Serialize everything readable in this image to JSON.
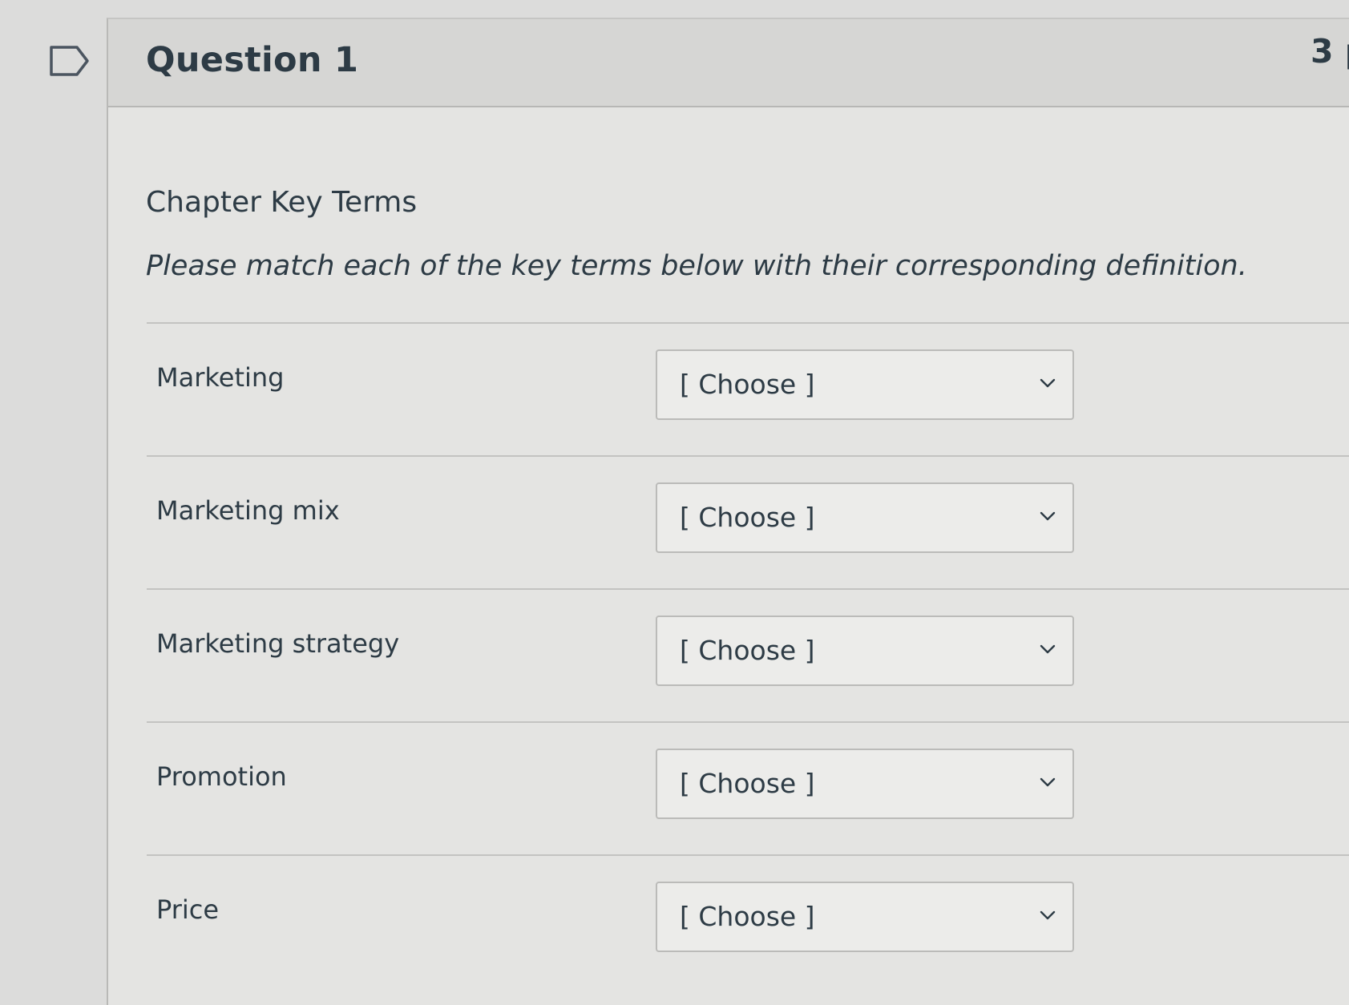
{
  "question": {
    "title": "Question 1",
    "points": "3 p"
  },
  "content": {
    "heading": "Chapter Key Terms",
    "instruction": "Please match each of the key terms below with their corresponding definition."
  },
  "matches": [
    {
      "term": "Marketing",
      "selected": "[ Choose ]"
    },
    {
      "term": "Marketing mix",
      "selected": "[ Choose ]"
    },
    {
      "term": "Marketing strategy",
      "selected": "[ Choose ]"
    },
    {
      "term": "Promotion",
      "selected": "[ Choose ]"
    },
    {
      "term": "Price",
      "selected": "[ Choose ]"
    }
  ],
  "icons": {
    "flag": "flag-outline-icon",
    "dropdown": "chevron-down-icon"
  },
  "colors": {
    "text": "#2d3b45",
    "page_background": "#dcdcdb",
    "card_background": "#e4e4e2",
    "header_background": "#d6d6d4"
  }
}
